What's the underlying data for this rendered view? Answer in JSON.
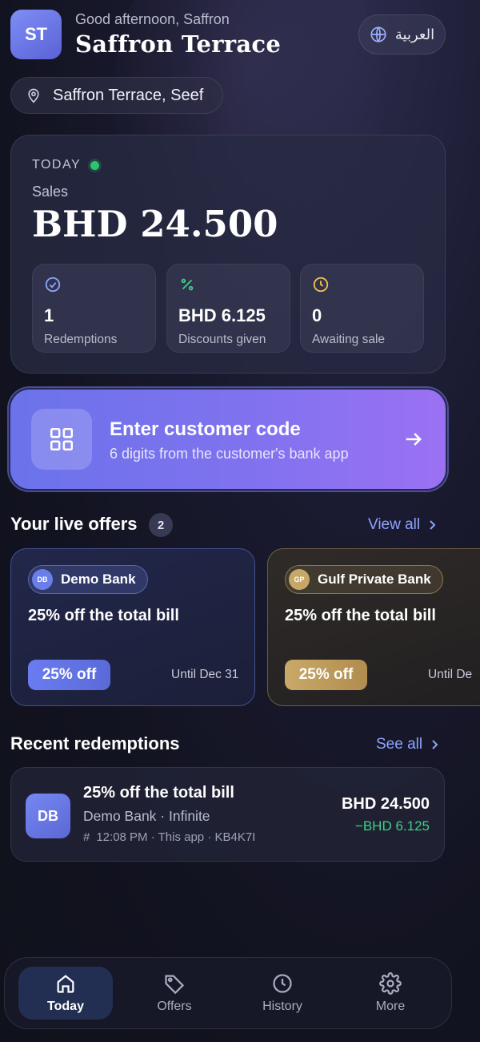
{
  "header": {
    "avatar_initials": "ST",
    "greeting": "Good afternoon, Saffron",
    "store_name": "Saffron Terrace",
    "language_label": "العربية",
    "location": "Saffron Terrace, Seef"
  },
  "today": {
    "label": "TODAY",
    "sales_label": "Sales",
    "sales_value": "BHD 24.500",
    "stats": [
      {
        "value": "1",
        "label": "Redemptions",
        "icon": "check-badge-icon",
        "color": "#8fa2ff"
      },
      {
        "value": "BHD 6.125",
        "label": "Discounts given",
        "icon": "percent-icon",
        "color": "#3fcf86"
      },
      {
        "value": "0",
        "label": "Awaiting sale",
        "icon": "clock-icon",
        "color": "#f2c14e"
      }
    ]
  },
  "enter_code": {
    "title": "Enter customer code",
    "subtitle": "6 digits from the customer's bank app"
  },
  "offers": {
    "title": "Your live offers",
    "count": "2",
    "view_all": "View all",
    "items": [
      {
        "bank_initials": "DB",
        "bank": "Demo Bank",
        "title": "25% off the total bill",
        "pct": "25% off",
        "until": "Until Dec 31"
      },
      {
        "bank_initials": "GP",
        "bank": "Gulf Private Bank",
        "title": "25% off the total bill",
        "pct": "25% off",
        "until": "Until De"
      }
    ]
  },
  "recent": {
    "title": "Recent redemptions",
    "see_all": "See all",
    "items": [
      {
        "initials": "DB",
        "title": "25% off the total bill",
        "bank_tier": "Demo Bank · Infinite",
        "meta": "12:08 PM · This app · KB4K7I",
        "amount": "BHD 24.500",
        "discount": "−BHD 6.125"
      }
    ]
  },
  "nav": {
    "items": [
      {
        "label": "Today",
        "icon": "home-icon"
      },
      {
        "label": "Offers",
        "icon": "tag-icon"
      },
      {
        "label": "History",
        "icon": "clock-icon"
      },
      {
        "label": "More",
        "icon": "gear-icon"
      }
    ]
  }
}
